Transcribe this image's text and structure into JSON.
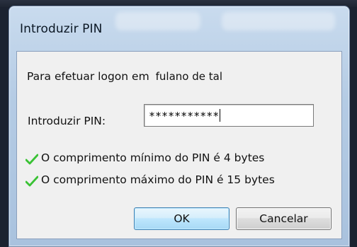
{
  "dialog": {
    "title": "Introduzir PIN",
    "logon_label": "Para efetuar logon em",
    "logon_user": "fulano de tal",
    "pin_label": "Introduzir PIN:",
    "pin_value": "***********",
    "rules": [
      {
        "text": "O comprimento mínimo do PIN é 4 bytes",
        "icon": "check-icon",
        "color": "#39c234"
      },
      {
        "text": "O comprimento máximo do PIN é 15 bytes",
        "icon": "check-icon",
        "color": "#39c234"
      }
    ],
    "ok_label": "OK",
    "cancel_label": "Cancelar"
  }
}
